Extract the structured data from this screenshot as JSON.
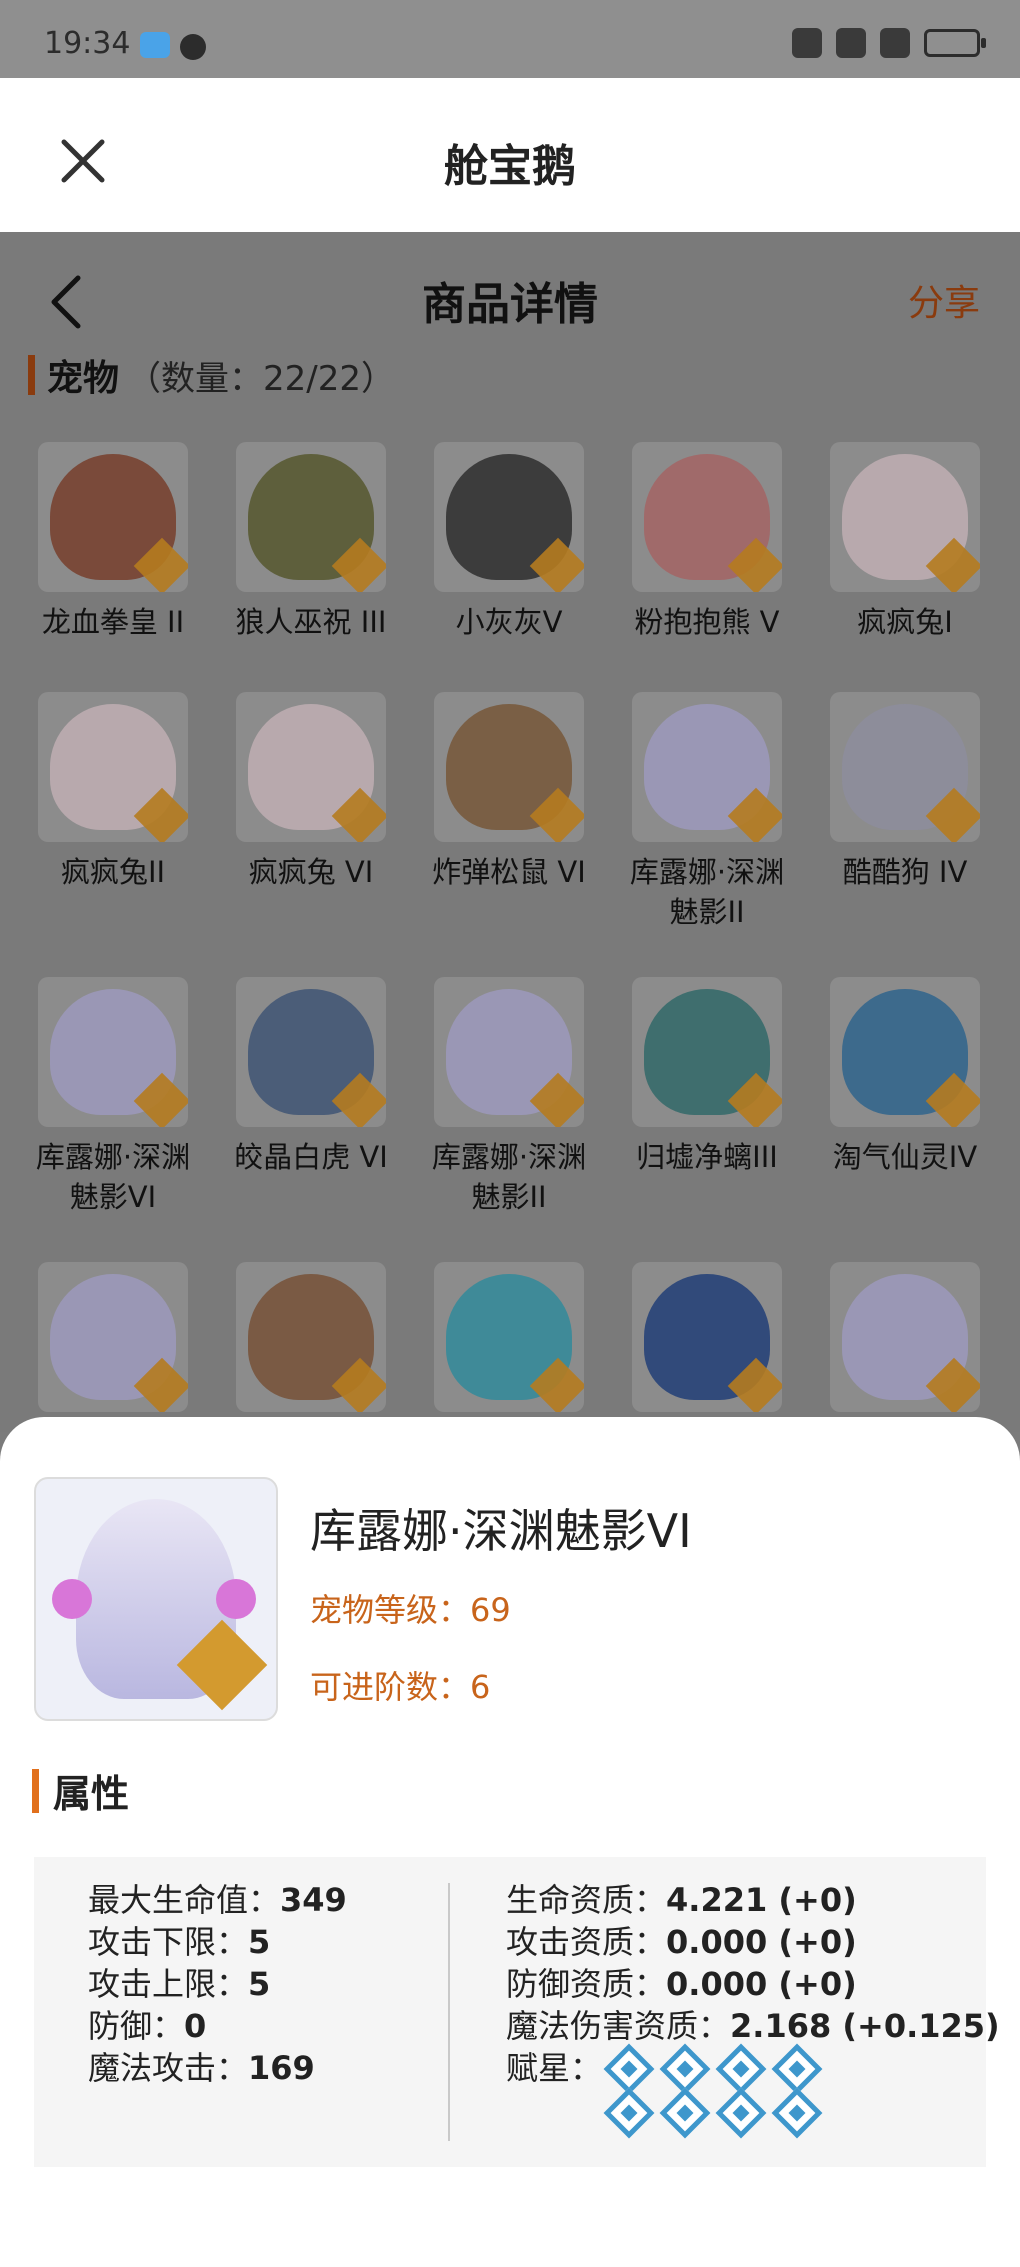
{
  "status_bar": {
    "time": "19:34"
  },
  "topbar": {
    "title": "舱宝鹅"
  },
  "page": {
    "title": "商品详情",
    "share_label": "分享",
    "section_label": "宠物",
    "section_count": "（数量：22/22）"
  },
  "pets": [
    {
      "name": "龙血拳皇 II",
      "color": "#7a4a3a"
    },
    {
      "name": "狼人巫祝 III",
      "color": "#5e5f3c"
    },
    {
      "name": "小灰灰V",
      "color": "#3c3c3c"
    },
    {
      "name": "粉抱抱熊 V",
      "color": "#a06a6a"
    },
    {
      "name": "疯疯兔I",
      "color": "#b8a9ad"
    },
    {
      "name": "疯疯兔II",
      "color": "#b8a9ad"
    },
    {
      "name": "疯疯兔 VI",
      "color": "#b8a9ad"
    },
    {
      "name": "炸弹松鼠 VI",
      "color": "#7a5f45"
    },
    {
      "name": "库露娜·深渊魅影II",
      "color": "#9a97b5"
    },
    {
      "name": "酷酷狗 IV",
      "color": "#8d8d9a"
    },
    {
      "name": "库露娜·深渊魅影VI",
      "color": "#9a97b5"
    },
    {
      "name": "皎晶白虎 VI",
      "color": "#4b5d78"
    },
    {
      "name": "库露娜·深渊魅影II",
      "color": "#9a97b5"
    },
    {
      "name": "归墟净螭III",
      "color": "#3f6e6e"
    },
    {
      "name": "淘气仙灵IV",
      "color": "#3d6a8c"
    },
    {
      "name": "",
      "color": "#9a97b5"
    },
    {
      "name": "",
      "color": "#7a5a44"
    },
    {
      "name": "",
      "color": "#3f8a98"
    },
    {
      "name": "",
      "color": "#314a7a"
    },
    {
      "name": "",
      "color": "#9a97b5"
    }
  ],
  "detail": {
    "name": "库露娜·深渊魅影VI",
    "level": "宠物等级：69",
    "advance": "可进阶数：6",
    "attr_title": "属性"
  },
  "attributes": {
    "left": [
      {
        "label": "最大生命值：",
        "value": "349"
      },
      {
        "label": "攻击下限：",
        "value": "5"
      },
      {
        "label": "攻击上限：",
        "value": "5"
      },
      {
        "label": "防御：",
        "value": "0"
      },
      {
        "label": "魔法攻击：",
        "value": "169"
      }
    ],
    "right": [
      {
        "label": "生命资质：",
        "value": "4.221 (+0)"
      },
      {
        "label": "攻击资质：",
        "value": "0.000 (+0)"
      },
      {
        "label": "防御资质：",
        "value": "0.000 (+0)"
      },
      {
        "label": "魔法伤害资质：",
        "value": "2.168 (+0.125)"
      }
    ],
    "stars_label": "赋星：",
    "stars_count": 8
  }
}
